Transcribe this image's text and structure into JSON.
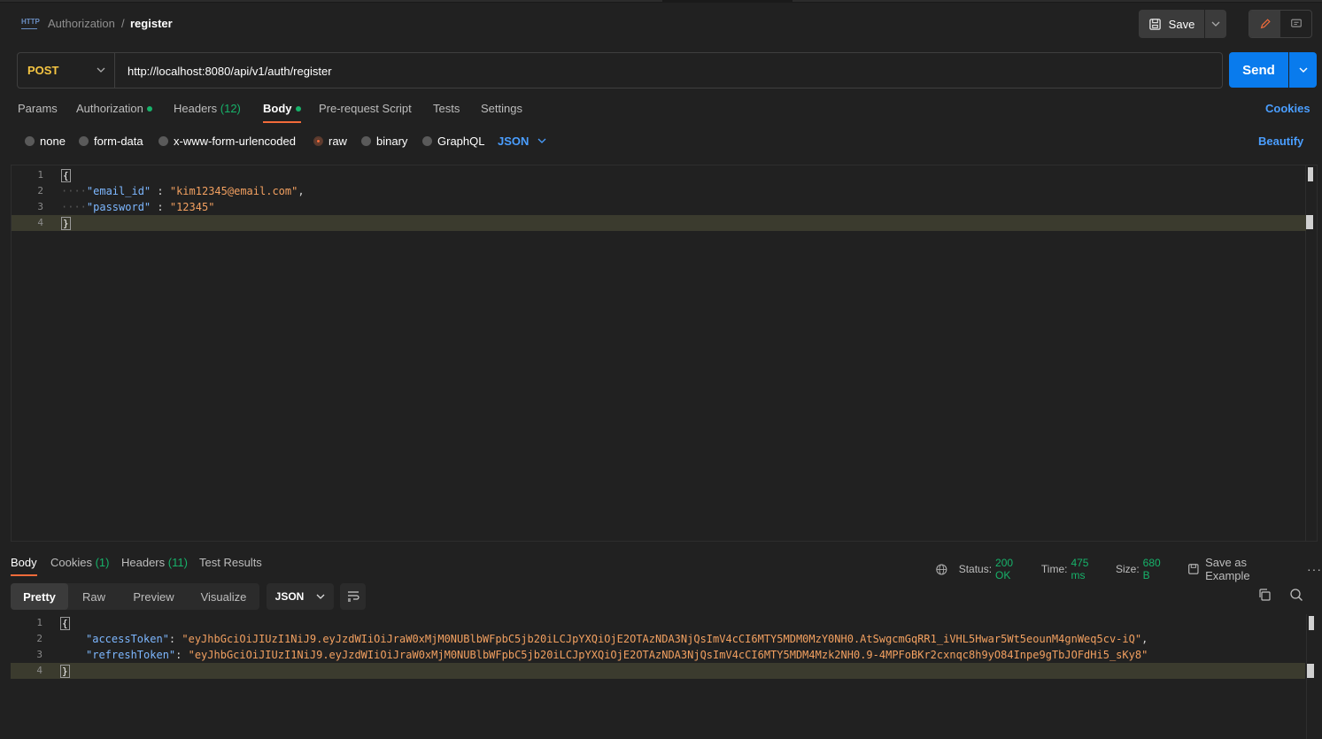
{
  "header": {
    "icon": "http-icon",
    "breadcrumb_parent": "Authorization",
    "breadcrumb_sep": "/",
    "breadcrumb_current": "register",
    "save_label": "Save"
  },
  "request": {
    "method": "POST",
    "url": "http://localhost:8080/api/v1/auth/register",
    "send_label": "Send",
    "tabs": {
      "params": "Params",
      "authorization": "Authorization",
      "headers": "Headers",
      "headers_count": "(12)",
      "body": "Body",
      "prerequest": "Pre-request Script",
      "tests": "Tests",
      "settings": "Settings"
    },
    "cookies_label": "Cookies",
    "body_modes": {
      "none": "none",
      "form_data": "form-data",
      "urlencoded": "x-www-form-urlencoded",
      "raw": "raw",
      "binary": "binary",
      "graphql": "GraphQL",
      "selected_lang": "JSON"
    },
    "beautify_label": "Beautify",
    "line_numbers": [
      "1",
      "2",
      "3",
      "4"
    ],
    "body_lines": {
      "open": "{",
      "l2_key": "\"email_id\"",
      "l2_colon": " : ",
      "l2_val": "\"kim12345@email.com\"",
      "l2_comma": ",",
      "l3_key": "\"password\"",
      "l3_colon": " : ",
      "l3_val": "\"12345\"",
      "close": "}"
    }
  },
  "response": {
    "tabs": {
      "body": "Body",
      "cookies": "Cookies",
      "cookies_count": "(1)",
      "headers": "Headers",
      "headers_count": "(11)",
      "test_results": "Test Results"
    },
    "status_label": "Status:",
    "status_value": "200 OK",
    "time_label": "Time:",
    "time_value": "475 ms",
    "size_label": "Size:",
    "size_value": "680 B",
    "save_example": "Save as Example",
    "formats": {
      "pretty": "Pretty",
      "raw": "Raw",
      "preview": "Preview",
      "visualize": "Visualize"
    },
    "lang": "JSON",
    "line_numbers": [
      "1",
      "2",
      "3",
      "4"
    ],
    "body_lines": {
      "open": "{",
      "l2_key": "\"accessToken\"",
      "l2_colon": ": ",
      "l2_val": "\"eyJhbGciOiJIUzI1NiJ9.eyJzdWIiOiJraW0xMjM0NUBlbWFpbC5jb20iLCJpYXQiOjE2OTAzNDA3NjQsImV4cCI6MTY5MDM0MzY0NH0.AtSwgcmGqRR1_iVHL5Hwar5Wt5eounM4gnWeq5cv-iQ\"",
      "l2_comma": ",",
      "l3_key": "\"refreshToken\"",
      "l3_colon": ": ",
      "l3_val": "\"eyJhbGciOiJIUzI1NiJ9.eyJzdWIiOiJraW0xMjM0NUBlbWFpbC5jb20iLCJpYXQiOjE2OTAzNDA3NjQsImV4cCI6MTY5MDM4Mzk2NH0.9-4MPFoBKr2cxnqc8h9yO84Inpe9gTbJOFdHi5_sKy8\"",
      "close": "}"
    }
  },
  "colors": {
    "accent": "#f26b3a",
    "send": "#097bed",
    "link": "#4a9eff",
    "success": "#17b26a",
    "method": "#f5c542"
  }
}
